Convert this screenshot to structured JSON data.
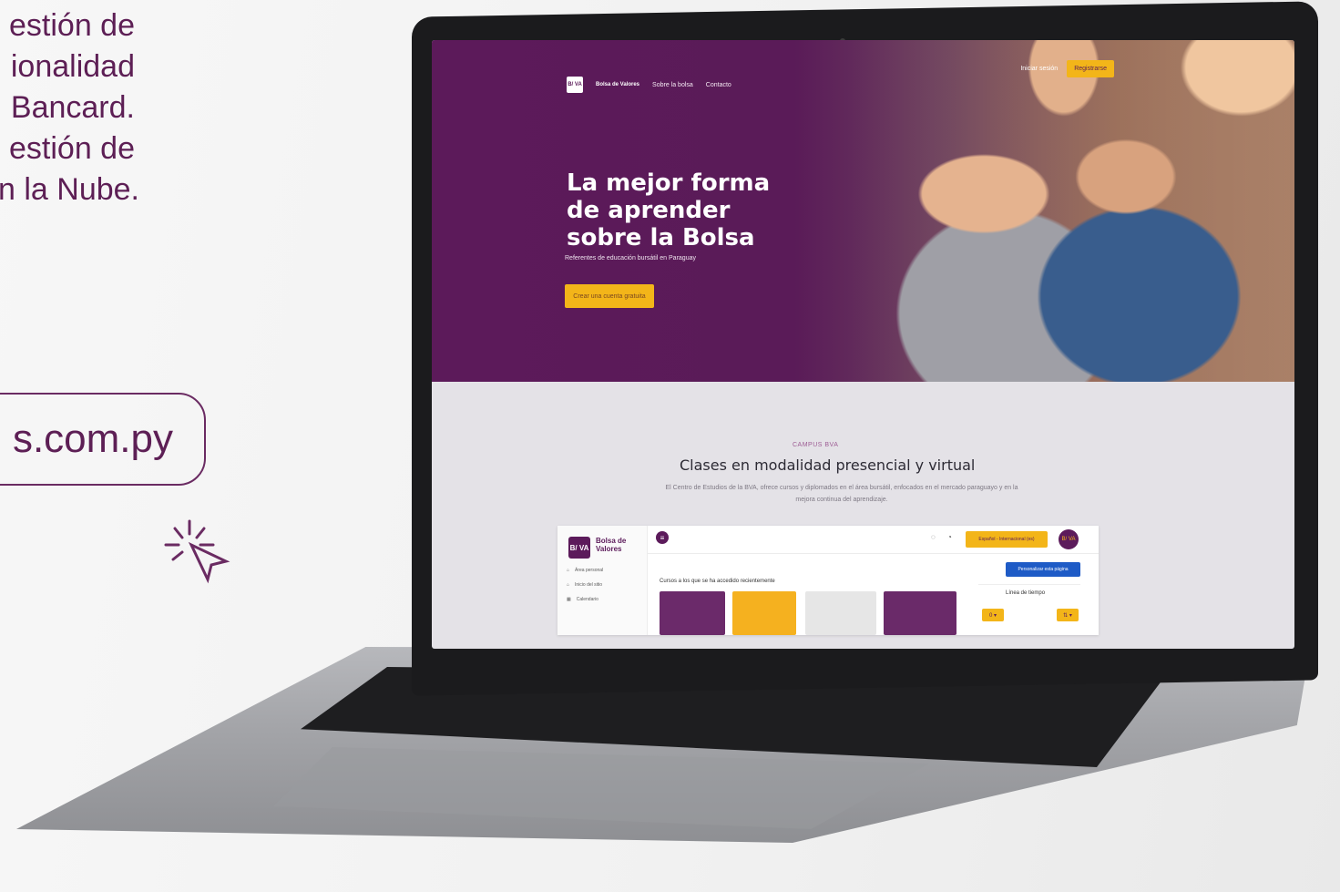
{
  "left_text_lines": [
    "estión de",
    "ionalidad",
    "Bancard.",
    "estión de",
    "n la Nube."
  ],
  "url_text": "s.com.py",
  "screen": {
    "nav": {
      "logo": "B/ VA",
      "logo_text": "Bolsa de Valores",
      "links": [
        "Sobre la bolsa",
        "Contacto"
      ],
      "login": "Iniciar sesión",
      "register": "Registrarse"
    },
    "hero": {
      "headline": "La mejor forma de aprender sobre la Bolsa",
      "subtitle": "Referentes de educación bursátil en Paraguay",
      "cta": "Crear una cuenta gratuita"
    },
    "section": {
      "kicker": "CAMPUS BVA",
      "title": "Clases en modalidad presencial y virtual",
      "description": "El Centro de Estudios de la BVA, ofrece cursos y diplomados en el área bursátil, enfocados en el mercado paraguayo y en la mejora continua del aprendizaje."
    },
    "app": {
      "logo_text": "Bolsa de Valores",
      "menu": [
        "Área personal",
        "Inicio del sitio",
        "Calendario"
      ],
      "lang": "Español - Internacional (es)",
      "avatar": "B/ VA",
      "personalize": "Personalizar esta página",
      "courses_title": "Cursos a los que se ha accedido recientemente",
      "timeline_title": "Línea de tiempo",
      "timeline_left": "0 ▾",
      "timeline_right": "⇅ ▾"
    }
  },
  "colors": {
    "brand_purple": "#5c1b5b",
    "accent_yellow": "#f3b519",
    "blue": "#1e5bc6"
  }
}
